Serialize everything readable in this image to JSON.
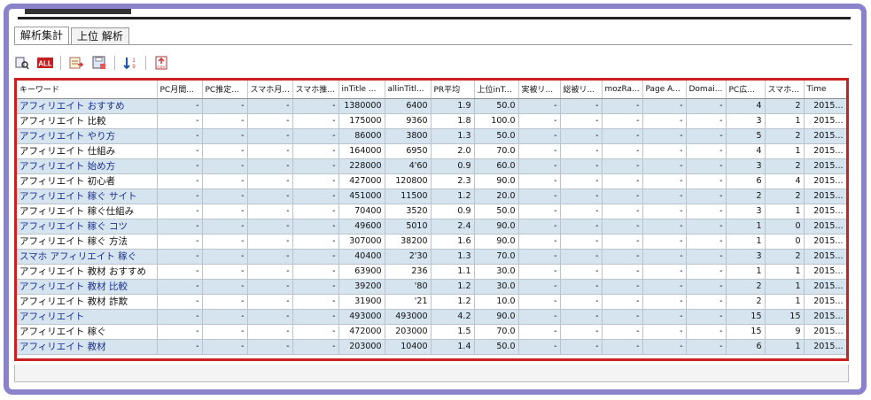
{
  "tabs": [
    {
      "label": "解析集計",
      "active": true
    },
    {
      "label": "上位 解析",
      "active": false
    }
  ],
  "toolbar": {
    "icons": [
      "search-list-icon",
      "all-icon",
      "export-list-icon",
      "save-icon",
      "sort-icon",
      "csv-export-icon"
    ]
  },
  "table": {
    "columns": [
      "キーワード",
      "PC月間...",
      "PC推定...",
      "スマホ月...",
      "スマホ推...",
      "inTitle ...",
      "allinTitl...",
      "PR平均",
      "上位inT...",
      "実被リ...",
      "総被リ...",
      "mozRa...",
      "Page A...",
      "Domai...",
      "PC広...",
      "スマホ...",
      "Time"
    ],
    "rows": [
      [
        "アフィリエイト おすすめ",
        "-",
        "-",
        "-",
        "-",
        "1380000",
        "6400",
        "1.9",
        "50.0",
        "-",
        "-",
        "-",
        "-",
        "-",
        "4",
        "2",
        "2015..."
      ],
      [
        "アフィリエイト 比較",
        "-",
        "-",
        "-",
        "-",
        "175000",
        "9360",
        "1.8",
        "100.0",
        "-",
        "-",
        "-",
        "-",
        "-",
        "3",
        "1",
        "2015..."
      ],
      [
        "アフィリエイト やり方",
        "-",
        "-",
        "-",
        "-",
        "86000",
        "3800",
        "1.3",
        "50.0",
        "-",
        "-",
        "-",
        "-",
        "-",
        "5",
        "2",
        "2015..."
      ],
      [
        "アフィリエイト 仕組み",
        "-",
        "-",
        "-",
        "-",
        "164000",
        "6950",
        "2.0",
        "70.0",
        "-",
        "-",
        "-",
        "-",
        "-",
        "4",
        "1",
        "2015..."
      ],
      [
        "アフィリエイト 始め方",
        "-",
        "-",
        "-",
        "-",
        "228000",
        "4'60",
        "0.9",
        "60.0",
        "-",
        "-",
        "-",
        "-",
        "-",
        "3",
        "2",
        "2015..."
      ],
      [
        "アフィリエイト 初心者",
        "-",
        "-",
        "-",
        "-",
        "427000",
        "120800",
        "2.3",
        "90.0",
        "-",
        "-",
        "-",
        "-",
        "-",
        "6",
        "4",
        "2015..."
      ],
      [
        "アフィリエイト 稼ぐ サイト",
        "-",
        "-",
        "-",
        "-",
        "451000",
        "11500",
        "1.2",
        "20.0",
        "-",
        "-",
        "-",
        "-",
        "-",
        "2",
        "2",
        "2015..."
      ],
      [
        "アフィリエイト 稼ぐ仕組み",
        "-",
        "-",
        "-",
        "-",
        "70400",
        "3520",
        "0.9",
        "50.0",
        "-",
        "-",
        "-",
        "-",
        "-",
        "3",
        "1",
        "2015..."
      ],
      [
        "アフィリエイト 稼ぐ コツ",
        "-",
        "-",
        "-",
        "-",
        "49600",
        "5010",
        "2.4",
        "90.0",
        "-",
        "-",
        "-",
        "-",
        "-",
        "1",
        "0",
        "2015..."
      ],
      [
        "アフィリエイト 稼ぐ 方法",
        "-",
        "-",
        "-",
        "-",
        "307000",
        "38200",
        "1.6",
        "90.0",
        "-",
        "-",
        "-",
        "-",
        "-",
        "1",
        "0",
        "2015..."
      ],
      [
        "スマホ アフィリエイト 稼ぐ",
        "-",
        "-",
        "-",
        "-",
        "40400",
        "2'30",
        "1.3",
        "70.0",
        "-",
        "-",
        "-",
        "-",
        "-",
        "3",
        "2",
        "2015..."
      ],
      [
        "アフィリエイト 教材 おすすめ",
        "-",
        "-",
        "-",
        "-",
        "63900",
        "236",
        "1.1",
        "30.0",
        "-",
        "-",
        "-",
        "-",
        "-",
        "1",
        "1",
        "2015..."
      ],
      [
        "アフィリエイト 教材 比較",
        "-",
        "-",
        "-",
        "-",
        "39200",
        "'80",
        "1.2",
        "30.0",
        "-",
        "-",
        "-",
        "-",
        "-",
        "2",
        "1",
        "2015..."
      ],
      [
        "アフィリエイト 教材 詐欺",
        "-",
        "-",
        "-",
        "-",
        "31900",
        "'21",
        "1.2",
        "10.0",
        "-",
        "-",
        "-",
        "-",
        "-",
        "2",
        "1",
        "2015..."
      ],
      [
        "アフィリエイト",
        "-",
        "-",
        "-",
        "-",
        "493000",
        "493000",
        "4.2",
        "90.0",
        "-",
        "-",
        "-",
        "-",
        "-",
        "15",
        "15",
        "2015..."
      ],
      [
        "アフィリエイト 稼ぐ",
        "-",
        "-",
        "-",
        "-",
        "472000",
        "203000",
        "1.5",
        "70.0",
        "-",
        "-",
        "-",
        "-",
        "-",
        "15",
        "9",
        "2015..."
      ],
      [
        "アフィリエイト 教材",
        "-",
        "-",
        "-",
        "-",
        "203000",
        "10400",
        "1.4",
        "50.0",
        "-",
        "-",
        "-",
        "-",
        "-",
        "6",
        "1",
        "2015..."
      ]
    ]
  },
  "colors": {
    "frame": "#8a83cc",
    "highlight_border": "#cc1f1f",
    "row_alt": "#d6e4f0",
    "keyword_text": "#1a2f8f"
  }
}
